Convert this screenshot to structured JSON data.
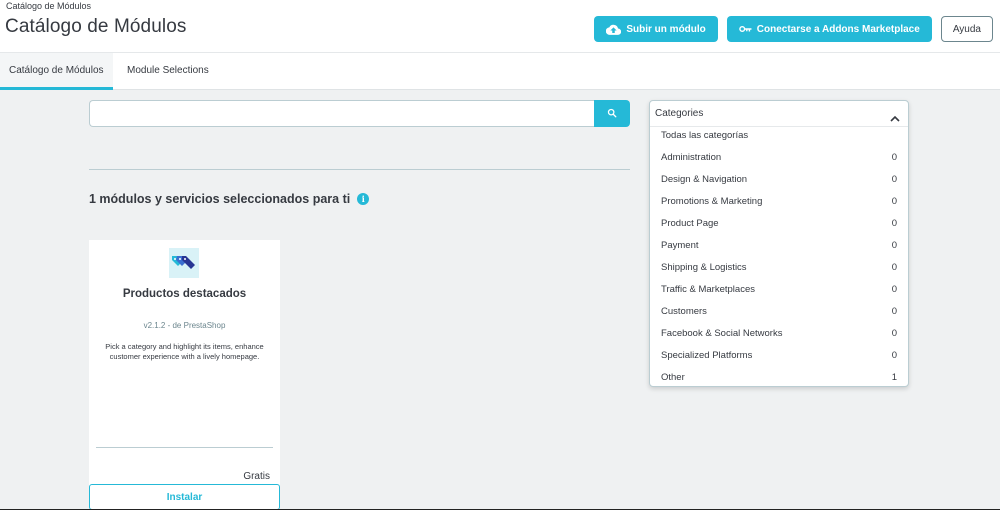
{
  "header": {
    "breadcrumb": "Catálogo de Módulos",
    "title": "Catálogo de Módulos",
    "buttons": {
      "upload": "Subir un módulo",
      "connect": "Conectarse a Addons Marketplace",
      "help": "Ayuda"
    }
  },
  "tabs": [
    {
      "label": "Catálogo de Módulos",
      "active": true
    },
    {
      "label": "Module Selections",
      "active": false
    }
  ],
  "search": {
    "value": "",
    "placeholder": ""
  },
  "section": {
    "title": "1 módulos y servicios seleccionados para ti",
    "info_icon": "info-icon"
  },
  "module": {
    "name": "Productos destacados",
    "version": "v2.1.2 - de PrestaShop",
    "description": "Pick a category and highlight its items, enhance customer experience with a lively homepage.",
    "price": "Gratis",
    "install_label": "Instalar",
    "icon": "tags-icon"
  },
  "categories": {
    "label": "Categories",
    "items": [
      {
        "label": "Todas las categorías",
        "count": ""
      },
      {
        "label": "Administration",
        "count": "0"
      },
      {
        "label": "Design & Navigation",
        "count": "0"
      },
      {
        "label": "Promotions & Marketing",
        "count": "0"
      },
      {
        "label": "Product Page",
        "count": "0"
      },
      {
        "label": "Payment",
        "count": "0"
      },
      {
        "label": "Shipping & Logistics",
        "count": "0"
      },
      {
        "label": "Traffic & Marketplaces",
        "count": "0"
      },
      {
        "label": "Customers",
        "count": "0"
      },
      {
        "label": "Facebook & Social Networks",
        "count": "0"
      },
      {
        "label": "Specialized Platforms",
        "count": "0"
      },
      {
        "label": "Other",
        "count": "1"
      }
    ]
  },
  "colors": {
    "accent": "#25b9d7",
    "text": "#363a41",
    "background": "#eff1f2"
  }
}
